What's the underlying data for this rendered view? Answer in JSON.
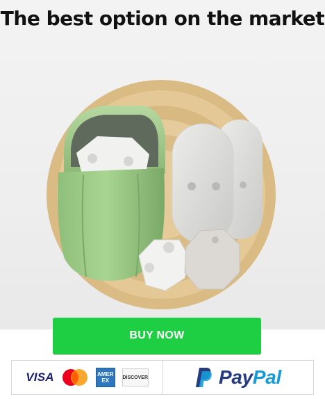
{
  "hero": {
    "headline": "The best option on the market",
    "image_alt": "Product photo: green charging case with pods and adhesive electrode pads"
  },
  "cta": {
    "buy_label": "BUY NOW",
    "color": "#1fcf43"
  },
  "payments": {
    "visa_label": "VISA",
    "amex_line1": "AMER",
    "amex_line2": "EX",
    "discover_label": "DISCOVER",
    "paypal_part1": "Pay",
    "paypal_part2": "Pal",
    "icons": [
      "visa-icon",
      "mastercard-icon",
      "amex-icon",
      "discover-icon",
      "paypal-icon"
    ]
  },
  "colors": {
    "paypal_dark": "#253b80",
    "paypal_light": "#179bd7",
    "mastercard_red": "#eb001b",
    "mastercard_orange": "#f79e1b"
  }
}
